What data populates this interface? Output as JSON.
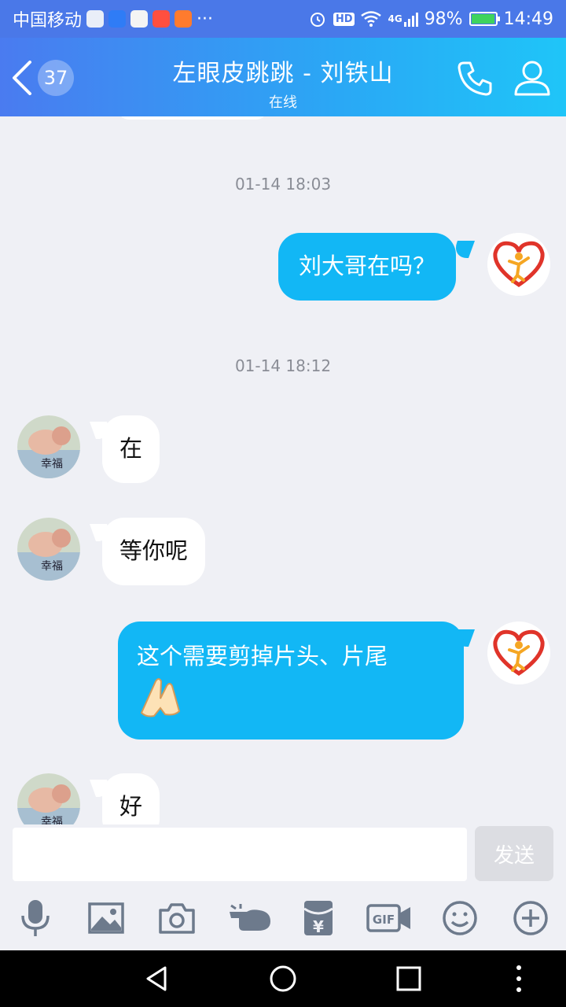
{
  "status_bar": {
    "carrier": "中国移动",
    "more": "···",
    "hd": "HD",
    "network": "4G",
    "battery": "98%",
    "battery_level": 0.98,
    "time": "14:49"
  },
  "header": {
    "back_count": "37",
    "title": "左眼皮跳跳 - 刘铁山",
    "status": "在线"
  },
  "messages": [
    {
      "type": "time",
      "text": "01-14 18:03"
    },
    {
      "type": "out",
      "text": "刘大哥在吗？"
    },
    {
      "type": "time",
      "text": "01-14 18:12"
    },
    {
      "type": "in",
      "text": "在"
    },
    {
      "type": "in",
      "text": "等你呢"
    },
    {
      "type": "out",
      "text": "这个需要剪掉片头、片尾"
    },
    {
      "type": "in",
      "text": "好"
    }
  ],
  "input": {
    "value": "",
    "send_label": "发送"
  },
  "toolbar": {
    "icons": [
      "microphone-icon",
      "image-icon",
      "camera-icon",
      "poke-icon",
      "red-packet-icon",
      "gif-icon",
      "emoji-icon",
      "plus-icon"
    ],
    "gif_label": "GIF",
    "red_packet_symbol": "¥"
  },
  "colors": {
    "header_start": "#4a7bf0",
    "header_end": "#1fc5f8",
    "out_bubble": "#12b7f5",
    "in_bubble": "#ffffff",
    "background": "#eff0f5"
  }
}
